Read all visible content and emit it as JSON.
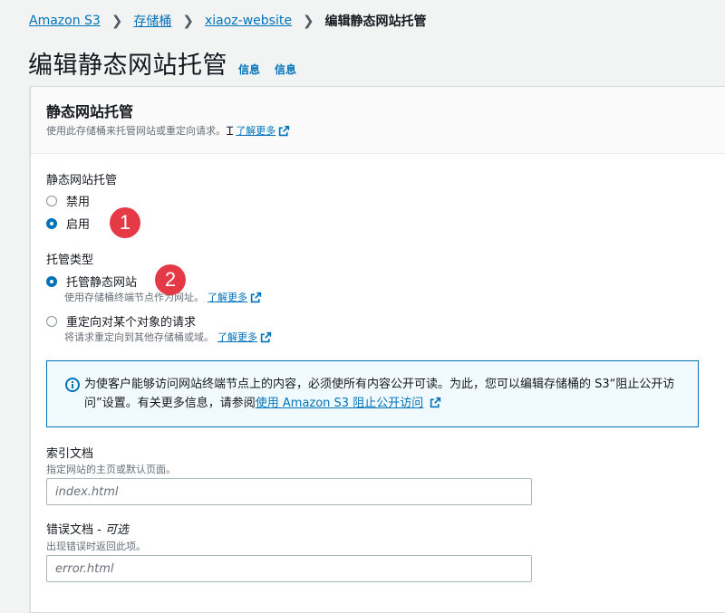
{
  "breadcrumb": {
    "items": [
      "Amazon S3",
      "存储桶",
      "xiaoz-website"
    ],
    "current": "编辑静态网站托管"
  },
  "page": {
    "title": "编辑静态网站托管",
    "info_links": [
      "信息",
      "信息"
    ]
  },
  "panel": {
    "title": "静态网站托管",
    "description": "使用此存储桶来托管网站或重定向请求。",
    "learn_more": "了解更多"
  },
  "hosting": {
    "label": "静态网站托管",
    "options": [
      {
        "label": "禁用",
        "selected": false
      },
      {
        "label": "启用",
        "selected": true
      }
    ]
  },
  "hosting_type": {
    "label": "托管类型",
    "options": [
      {
        "label": "托管静态网站",
        "description": "使用存储桶终端节点作为网址。",
        "learn_more": "了解更多",
        "selected": true
      },
      {
        "label": "重定向对某个对象的请求",
        "description": "将请求重定向到其他存储桶或域。",
        "learn_more": "了解更多",
        "selected": false
      }
    ]
  },
  "alert": {
    "text": "为使客户能够访问网站终端节点上的内容，必须使所有内容公开可读。为此，您可以编辑存储桶的 S3“阻止公开访问”设置。有关更多信息，请参阅",
    "link": "使用 Amazon S3 阻止公开访问"
  },
  "index_document": {
    "label": "索引文档",
    "description": "指定网站的主页或默认页面。",
    "placeholder": "index.html"
  },
  "error_document": {
    "label": "错误文档",
    "optional": "可选",
    "description": "出现错误时返回此项。",
    "placeholder": "error.html"
  },
  "annotations": [
    "1",
    "2"
  ],
  "colors": {
    "link": "#0073bb",
    "badge": "#e63946",
    "alert_bg": "#f1faff"
  },
  "icons": {
    "external": "external-link-icon",
    "info": "info-circle-icon",
    "separator": "chevron-right-icon"
  }
}
